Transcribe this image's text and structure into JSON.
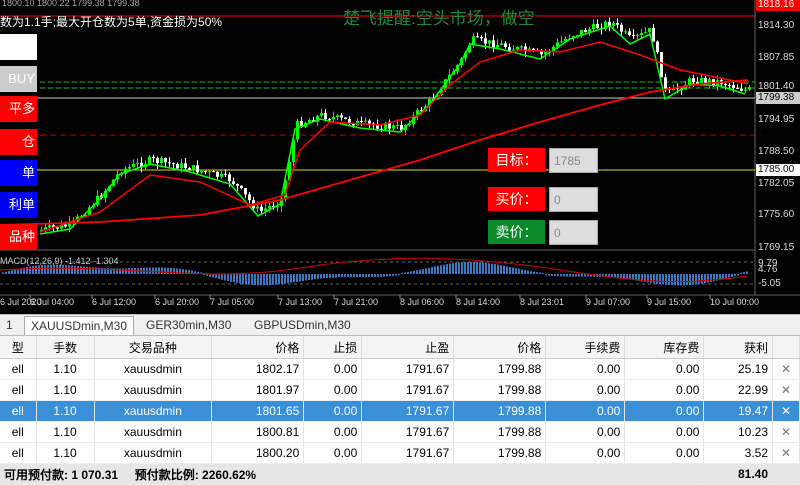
{
  "chart": {
    "top_info": "数为1.1手;最大开仓数为5单,资金损为50%",
    "watermark": "楚飞提醒:空头市场，做空",
    "header_text": "1800.10 1800.22 1799.38 1799.38",
    "price_axis": [
      "1818.16",
      "1814.30",
      "1807.85",
      "1801.40",
      "1794.95",
      "1788.50",
      "1782.05",
      "1775.60",
      "1769.15",
      "9.79",
      "4.76",
      "-5.05"
    ],
    "price_highlights": [
      {
        "label": "1818.16",
        "bg": "#ff0000"
      },
      {
        "label": "1799.38",
        "bg": "#cccccc"
      },
      {
        "label": "1785.00",
        "bg": "#ffffff"
      }
    ],
    "macd_label": "MACD(12,26,9) -1.412 -1.304",
    "time_axis": [
      "6 Jul 2020",
      "6 Jul 04:00",
      "6 Jul 12:00",
      "6 Jul 20:00",
      "7 Jul 05:00",
      "7 Jul 13:00",
      "7 Jul 21:00",
      "8 Jul 06:00",
      "8 Jul 14:00",
      "8 Jul 23:01",
      "9 Jul 07:00",
      "9 Jul 15:00",
      "10 Jul 00:00"
    ],
    "colors": {
      "up": "#00ff00",
      "down": "#ffffff",
      "ma_fast": "#00ff00",
      "ma_slow": "#ff0000",
      "macd": "#3a78c8"
    }
  },
  "left_buttons": [
    {
      "label": "",
      "bg": "#ffffff",
      "color": "#000000"
    },
    {
      "label": "BUY",
      "bg": "#cccccc",
      "color": "#ffffff"
    },
    {
      "label": "平多",
      "bg": "#ff0000",
      "color": "#ffffff"
    },
    {
      "label": "仓",
      "bg": "#ff0000",
      "color": "#ffffff"
    },
    {
      "label": "单",
      "bg": "#0000ff",
      "color": "#ffffff"
    },
    {
      "label": "利单",
      "bg": "#0000ff",
      "color": "#ffffff"
    },
    {
      "label": "品种",
      "bg": "#ff0000",
      "color": "#ffffff"
    }
  ],
  "panel": {
    "target_label": "目标：",
    "target_value": "1785",
    "buy_label": "买价：",
    "buy_value": "0",
    "sell_label": "卖价：",
    "sell_value": "0"
  },
  "tabs": [
    "1",
    "XAUUSDmin,M30",
    "GER30min,M30",
    "GBPUSDmin,M30"
  ],
  "table": {
    "headers": [
      "型",
      "手数",
      "交易品种",
      "价格",
      "止损",
      "止盈",
      "价格",
      "手续费",
      "库存费",
      "获利",
      ""
    ],
    "rows": [
      [
        "ell",
        "1.10",
        "xauusdmin",
        "1802.17",
        "0.00",
        "1791.67",
        "1799.88",
        "0.00",
        "0.00",
        "25.19",
        "✕"
      ],
      [
        "ell",
        "1.10",
        "xauusdmin",
        "1801.97",
        "0.00",
        "1791.67",
        "1799.88",
        "0.00",
        "0.00",
        "22.99",
        "✕"
      ],
      [
        "ell",
        "1.10",
        "xauusdmin",
        "1801.65",
        "0.00",
        "1791.67",
        "1799.88",
        "0.00",
        "0.00",
        "19.47",
        "✕"
      ],
      [
        "ell",
        "1.10",
        "xauusdmin",
        "1800.81",
        "0.00",
        "1791.67",
        "1799.88",
        "0.00",
        "0.00",
        "10.23",
        "✕"
      ],
      [
        "ell",
        "1.10",
        "xauusdmin",
        "1800.20",
        "0.00",
        "1791.67",
        "1799.88",
        "0.00",
        "0.00",
        "3.52",
        "✕"
      ]
    ],
    "selected_row": 2,
    "footer_left": "可用预付款: 1 070.31",
    "footer_mid": "预付款比例: 2260.62%",
    "footer_total": "81.40"
  }
}
